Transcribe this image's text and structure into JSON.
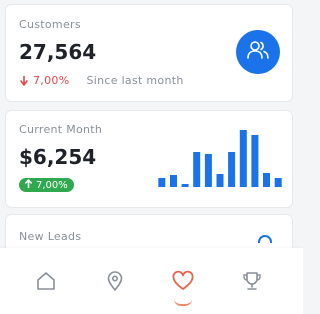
{
  "customers_card": {
    "title": "Customers",
    "value": "27,564",
    "trend_icon": "arrow-down-icon",
    "trend_value": "7,00%",
    "trend_caption": "Since last month",
    "icon": "users-icon"
  },
  "month_card": {
    "title": "Current Month",
    "value": "$6,254",
    "badge_icon": "arrow-up-icon",
    "badge_value": "7,00%"
  },
  "chart_data": {
    "type": "bar",
    "values": [
      9,
      12,
      3,
      35,
      33,
      13,
      35,
      57,
      52,
      14,
      9
    ],
    "ylim": [
      0,
      60
    ],
    "color": "#1a73e8"
  },
  "leads_card": {
    "title": "New Leads"
  },
  "bottom_nav": {
    "items": [
      {
        "icon": "home-icon",
        "active": false
      },
      {
        "icon": "location-icon",
        "active": false
      },
      {
        "icon": "heart-icon",
        "active": true
      },
      {
        "icon": "trophy-icon",
        "active": false
      }
    ]
  },
  "colors": {
    "primary": "#1a73e8",
    "positive": "#2fa84f",
    "negative": "#e0474c",
    "active_nav": "#e8614a",
    "inactive_nav": "#8a9098"
  }
}
